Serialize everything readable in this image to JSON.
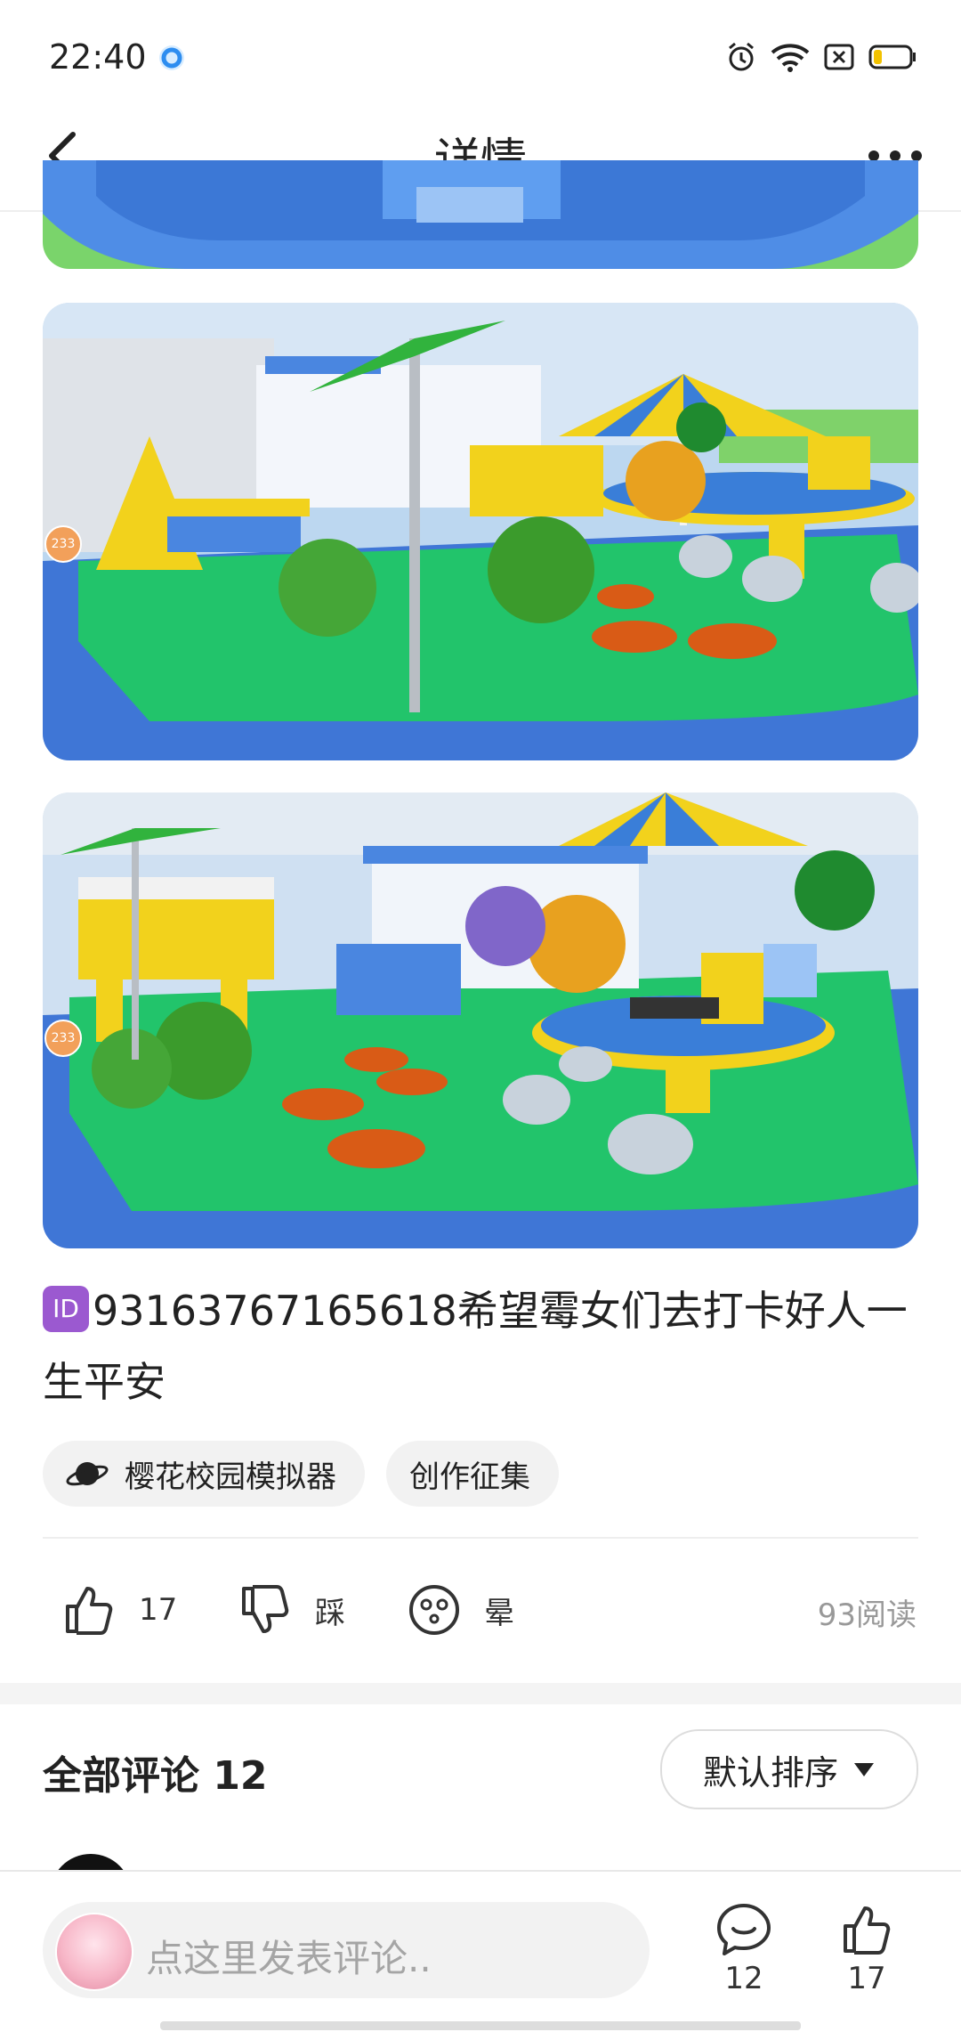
{
  "status_bar": {
    "time": "22:40"
  },
  "header": {
    "title": "详情"
  },
  "post": {
    "id_badge": "ID",
    "text": "93163767165618希望霉女们去打卡好人一生平安",
    "tags": [
      "樱花校园模拟器",
      "创作征集"
    ],
    "image_badge": "233"
  },
  "actions": {
    "like_count": "17",
    "dislike_label": "踩",
    "dizzy_label": "晕",
    "reads": "93阅读"
  },
  "comments": {
    "title": "全部评论 12",
    "sort_label": "默认排序"
  },
  "bottom_bar": {
    "placeholder": "点这里发表评论..",
    "comment_count": "12",
    "like_count": "17"
  },
  "colors": {
    "accent_purple": "#9b59d0",
    "grass_green": "#22c46b",
    "water_blue": "#4a86e0",
    "yellow": "#f2d21c"
  }
}
